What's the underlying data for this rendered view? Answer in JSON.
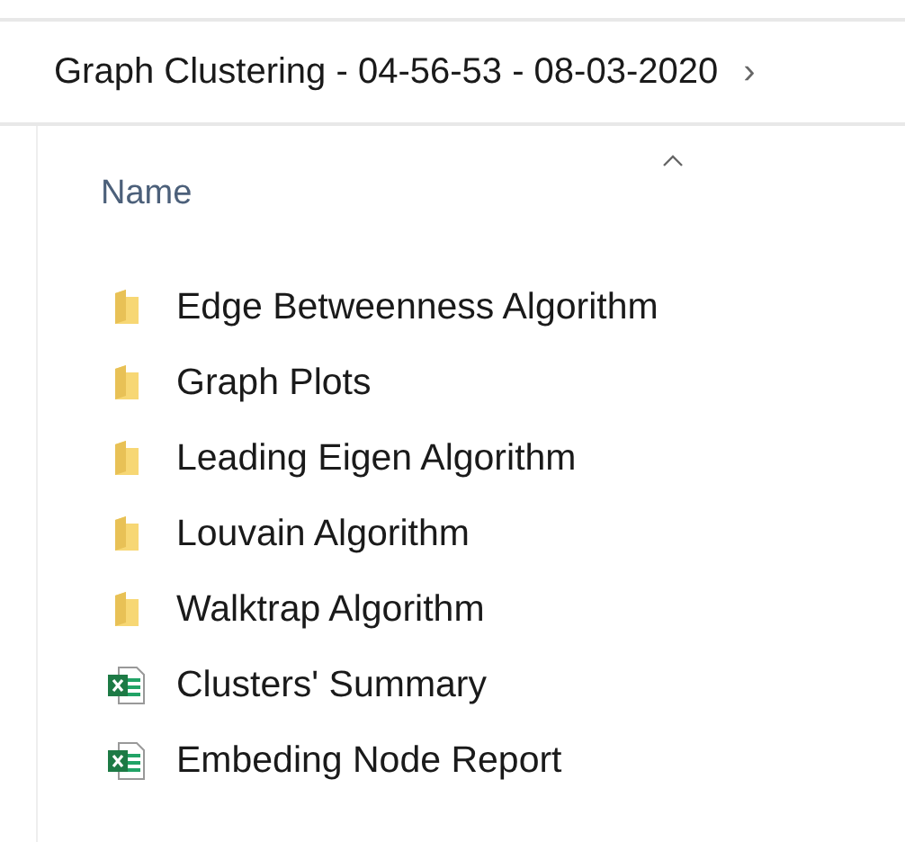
{
  "breadcrumb": {
    "label": "Graph Clustering - 04-56-53 - 08-03-2020",
    "chevron": "›"
  },
  "header": {
    "label": "Name",
    "sort_ascending": true
  },
  "items": [
    {
      "kind": "folder",
      "name": "Edge Betweenness Algorithm"
    },
    {
      "kind": "folder",
      "name": "Graph Plots"
    },
    {
      "kind": "folder",
      "name": "Leading Eigen Algorithm"
    },
    {
      "kind": "folder",
      "name": "Louvain Algorithm"
    },
    {
      "kind": "folder",
      "name": "Walktrap Algorithm"
    },
    {
      "kind": "spreadsheet",
      "name": "Clusters' Summary"
    },
    {
      "kind": "spreadsheet",
      "name": "Embeding Node Report"
    }
  ]
}
